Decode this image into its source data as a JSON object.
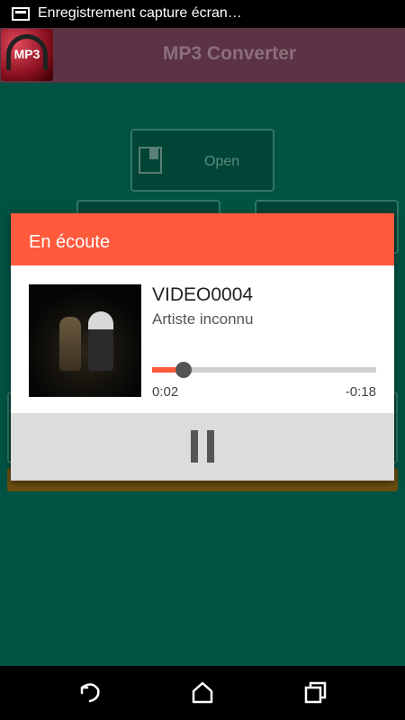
{
  "status_bar": {
    "notification_icon": "screenshot-icon",
    "text": "Enregistrement capture écran…"
  },
  "app_bar": {
    "logo_text": "MP3",
    "title": "MP3 Converter"
  },
  "background": {
    "open_button_label": "Open"
  },
  "dialog": {
    "title": "En écoute",
    "track_title": "VIDEO0004",
    "artist": "Artiste inconnu",
    "progress_fraction": 0.14,
    "time_elapsed": "0:02",
    "time_remaining": "-0:18",
    "pause_icon": "pause-icon"
  },
  "nav": {
    "back_icon": "back-icon",
    "home_icon": "home-icon",
    "recents_icon": "recents-icon"
  },
  "colors": {
    "background": "#005242",
    "app_bar": "#5c3344",
    "dialog_header": "#ff5a3c",
    "progress": "#ff5a3c"
  }
}
